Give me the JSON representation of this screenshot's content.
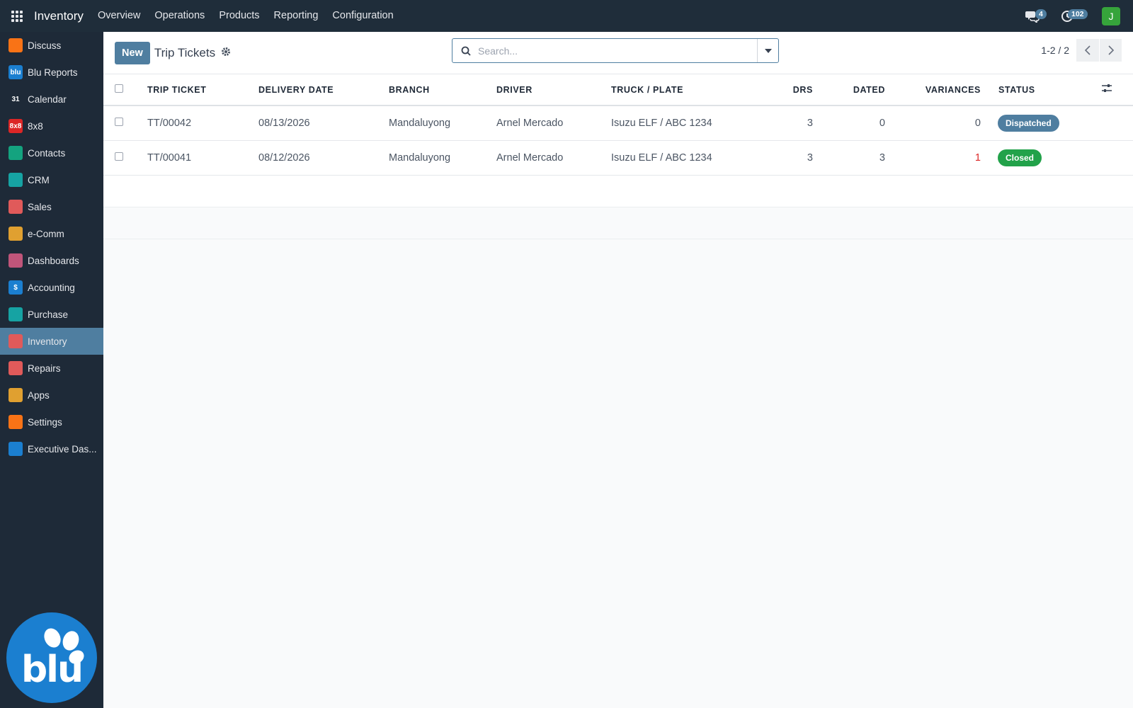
{
  "topbar": {
    "app_name": "Inventory",
    "nav": [
      "Overview",
      "Operations",
      "Products",
      "Reporting",
      "Configuration"
    ],
    "messages_count": "4",
    "activities_count": "102",
    "avatar_letter": "J"
  },
  "sidebar": {
    "items": [
      {
        "label": "Discuss",
        "icon": "discuss-icon",
        "color": "#f97316",
        "glyph": ""
      },
      {
        "label": "Blu Reports",
        "icon": "blu-reports-icon",
        "color": "#1b7fd0",
        "glyph": "blu"
      },
      {
        "label": "Calendar",
        "icon": "calendar-icon",
        "color": "#1e2a38",
        "glyph": "31"
      },
      {
        "label": "8x8",
        "icon": "eight-by-eight-icon",
        "color": "#dc2626",
        "glyph": "8x8"
      },
      {
        "label": "Contacts",
        "icon": "contacts-icon",
        "color": "#14a37f",
        "glyph": ""
      },
      {
        "label": "CRM",
        "icon": "crm-icon",
        "color": "#16a3a3",
        "glyph": ""
      },
      {
        "label": "Sales",
        "icon": "sales-icon",
        "color": "#e05a5a",
        "glyph": ""
      },
      {
        "label": "e-Comm",
        "icon": "ecommerce-icon",
        "color": "#e0a030",
        "glyph": ""
      },
      {
        "label": "Dashboards",
        "icon": "dashboards-icon",
        "color": "#c0557a",
        "glyph": ""
      },
      {
        "label": "Accounting",
        "icon": "accounting-icon",
        "color": "#1b7fd0",
        "glyph": "$"
      },
      {
        "label": "Purchase",
        "icon": "purchase-icon",
        "color": "#16a3a3",
        "glyph": ""
      },
      {
        "label": "Inventory",
        "icon": "inventory-icon",
        "color": "#e05a5a",
        "glyph": "",
        "active": true
      },
      {
        "label": "Repairs",
        "icon": "repairs-icon",
        "color": "#e05a5a",
        "glyph": ""
      },
      {
        "label": "Apps",
        "icon": "apps-icon",
        "color": "#e0a030",
        "glyph": ""
      },
      {
        "label": "Settings",
        "icon": "settings-icon",
        "color": "#f97316",
        "glyph": ""
      },
      {
        "label": "Executive Das...",
        "icon": "executive-dashboard-icon",
        "color": "#1b7fd0",
        "glyph": ""
      }
    ],
    "logo_text": "blu"
  },
  "control": {
    "new_label": "New",
    "title": "Trip Tickets",
    "search_placeholder": "Search...",
    "pager": "1-2 / 2"
  },
  "table": {
    "headers": {
      "trip_ticket": "TRIP TICKET",
      "delivery_date": "DELIVERY DATE",
      "branch": "BRANCH",
      "driver": "DRIVER",
      "truck_plate": "TRUCK / PLATE",
      "drs": "DRS",
      "dated": "DATED",
      "variances": "VARIANCES",
      "status": "STATUS"
    },
    "rows": [
      {
        "trip_ticket": "TT/00042",
        "delivery_date": "08/13/2026",
        "branch": "Mandaluyong",
        "driver": "Arnel Mercado",
        "truck_plate": "Isuzu ELF / ABC 1234",
        "drs": "3",
        "dated": "0",
        "variances": "0",
        "status": "Dispatched"
      },
      {
        "trip_ticket": "TT/00041",
        "delivery_date": "08/12/2026",
        "branch": "Mandaluyong",
        "driver": "Arnel Mercado",
        "truck_plate": "Isuzu ELF / ABC 1234",
        "drs": "3",
        "dated": "3",
        "variances": "1",
        "status": "Closed"
      }
    ]
  },
  "colors": {
    "accent": "#4f7ea0",
    "dispatched": "#4f7ea0",
    "closed": "#22a24a",
    "variance_alert": "#dc2626"
  }
}
